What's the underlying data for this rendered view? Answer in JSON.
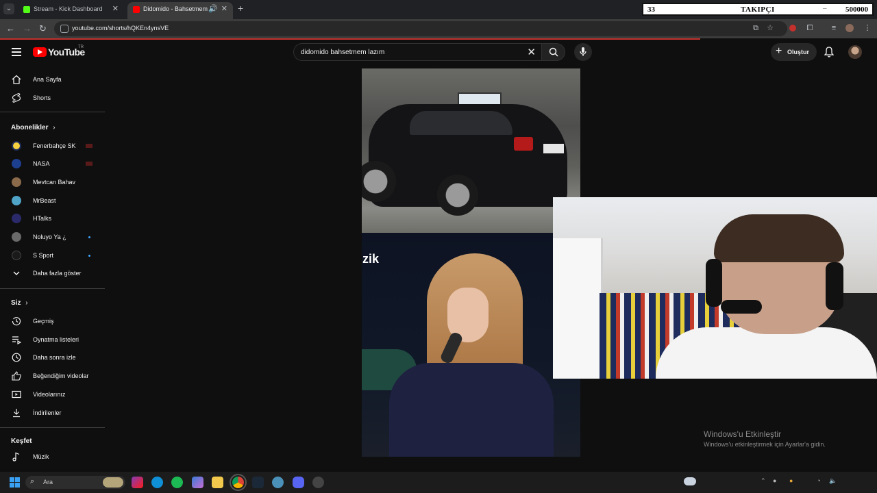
{
  "browser": {
    "tabs": [
      {
        "title": "Stream - Kick Dashboard",
        "favicon_color": "#53fc18"
      },
      {
        "title": "Didomido - Bahsetmem La",
        "favicon_color": "#ff0000"
      }
    ],
    "url": "youtube.com/shorts/hQKEn4ynsVE"
  },
  "overlay": {
    "count": "33",
    "label": "TAKIPÇI",
    "min": "–",
    "goal": "500000"
  },
  "header": {
    "logo": "YouTube",
    "region": "TR",
    "search_value": "didomido bahsetmem lazım",
    "create_label": "Oluştur"
  },
  "sidebar": {
    "top": [
      {
        "label": "Ana Sayfa",
        "icon": "home-icon"
      },
      {
        "label": "Shorts",
        "icon": "shorts-icon"
      }
    ],
    "subscriptions_heading": "Abonelikler",
    "subscriptions": [
      {
        "label": "Fenerbahçe SK",
        "avatar_color": "#f4d03f",
        "status": "live"
      },
      {
        "label": "NASA",
        "avatar_color": "#1d3f8f",
        "status": "live"
      },
      {
        "label": "Mevtcan Bahav",
        "avatar_color": "#8a6a4a",
        "status": ""
      },
      {
        "label": "MrBeast",
        "avatar_color": "#4fa3c7",
        "status": ""
      },
      {
        "label": "HTalks",
        "avatar_color": "#2a2a6a",
        "status": ""
      },
      {
        "label": "Noluyo Ya ¿",
        "avatar_color": "#6a6a6a",
        "status": "new"
      },
      {
        "label": "S Sport",
        "avatar_color": "#1a1a1a",
        "status": "new"
      }
    ],
    "show_more": "Daha fazla göster",
    "you_heading": "Siz",
    "you": [
      {
        "label": "Geçmiş",
        "icon": "history-icon"
      },
      {
        "label": "Oynatma listeleri",
        "icon": "playlists-icon"
      },
      {
        "label": "Daha sonra izle",
        "icon": "watch-later-icon"
      },
      {
        "label": "Beğendiğim videolar",
        "icon": "like-icon"
      },
      {
        "label": "Videolarınız",
        "icon": "your-videos-icon"
      },
      {
        "label": "İndirilenler",
        "icon": "download-icon"
      }
    ],
    "explore_heading": "Keşfet",
    "explore": [
      {
        "label": "Müzik",
        "icon": "music-icon"
      }
    ]
  },
  "video": {
    "caption": "zik"
  },
  "watermark": {
    "title": "Windows'u Etkinleştir",
    "subtitle": "Windows'u etkinleştirmek için Ayarlar'a gidin."
  },
  "taskbar": {
    "search_label": "Ara",
    "apps": [
      "instagram-icon",
      "edge-icon",
      "spotify-icon",
      "copilot-icon",
      "explorer-icon",
      "chrome-icon",
      "steam-icon",
      "settings-icon",
      "discord-icon",
      "recorder-icon"
    ]
  }
}
